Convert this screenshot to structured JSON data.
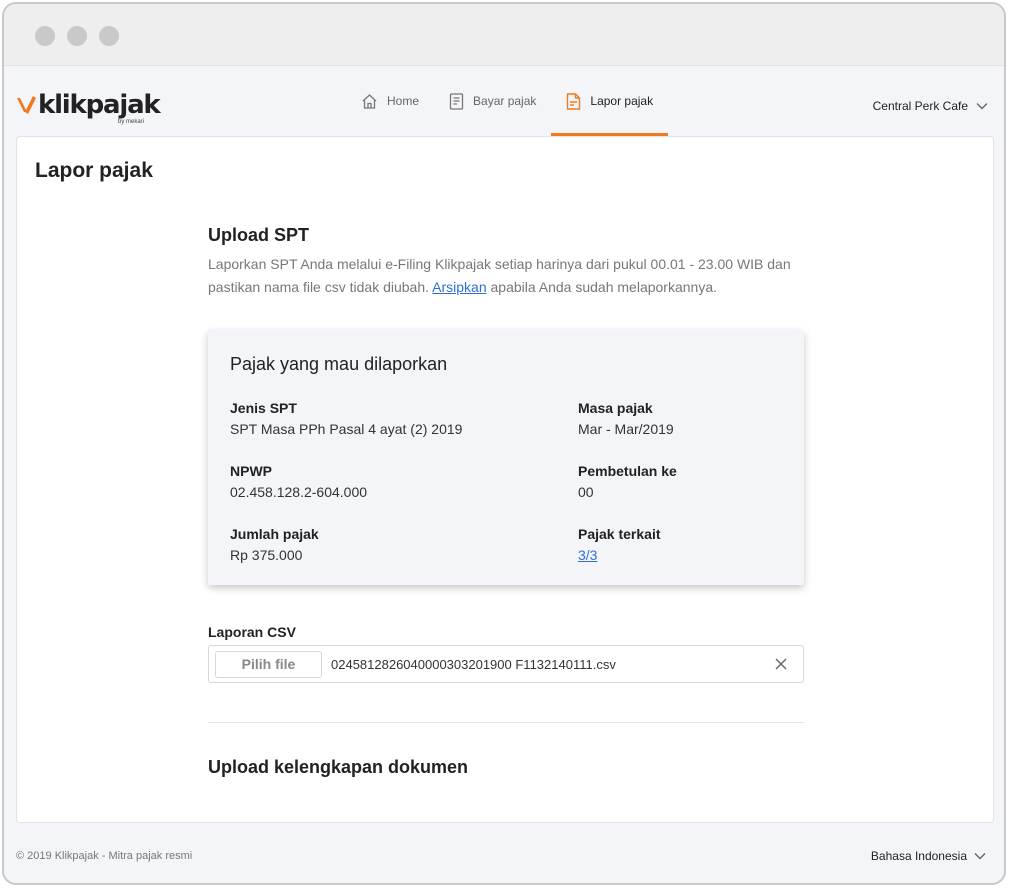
{
  "window": {
    "controls": [
      "close",
      "minimize",
      "maximize"
    ]
  },
  "brand": {
    "name": "klikpajak",
    "tagline": "by mekari",
    "accent": "#f07a1e"
  },
  "nav": {
    "items": [
      {
        "label": "Home",
        "icon": "home-icon",
        "active": false
      },
      {
        "label": "Bayar pajak",
        "icon": "receipt-icon",
        "active": false
      },
      {
        "label": "Lapor pajak",
        "icon": "report-document-icon",
        "active": true
      }
    ]
  },
  "account": {
    "name": "Central Perk Cafe",
    "icon": "chevron-down-icon"
  },
  "page": {
    "title": "Lapor pajak"
  },
  "upload": {
    "title": "Upload SPT",
    "desc_part1": "Laporkan SPT Anda melalui e-Filing Klikpajak setiap harinya dari pukul 00.01 - 23.00 WIB dan pastikan nama file csv tidak diubah.",
    "desc_link": "Arsipkan",
    "desc_part2": "apabila Anda sudah melaporkannya."
  },
  "summary": {
    "title": "Pajak yang mau dilaporkan",
    "jenis_spt": {
      "label": "Jenis SPT",
      "value": "SPT Masa PPh Pasal 4 ayat (2) 2019"
    },
    "masa_pajak": {
      "label": "Masa pajak",
      "value": "Mar - Mar/2019"
    },
    "npwp": {
      "label": "NPWP",
      "value": "02.458.128.2-604.000"
    },
    "pembetulan": {
      "label": "Pembetulan ke",
      "value": "00"
    },
    "jumlah_pajak": {
      "label": "Jumlah pajak",
      "value": "Rp 375.000"
    },
    "pajak_terkait": {
      "label": "Pajak terkait",
      "value": "3/3"
    }
  },
  "csv": {
    "label": "Laporan CSV",
    "button_label": "Pilih file",
    "file_name": "02458128260400003032019​00 F1132140111.csv"
  },
  "documents": {
    "title": "Upload kelengkapan dokumen"
  },
  "footer": {
    "copyright": "© 2019 Klikpajak - Mitra pajak resmi",
    "language": "Bahasa Indonesia"
  }
}
